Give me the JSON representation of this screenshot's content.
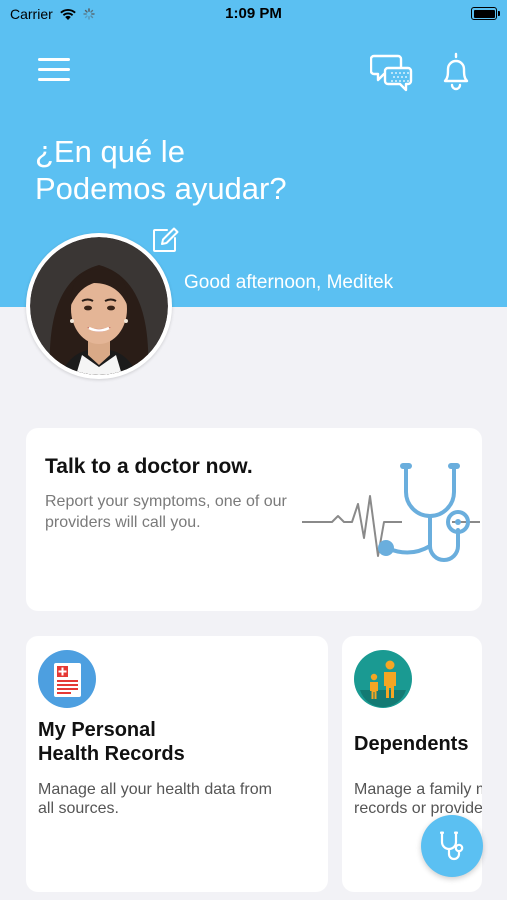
{
  "status_bar": {
    "carrier": "Carrier",
    "time": "1:09 PM"
  },
  "header": {
    "headline_line1": "¿En qué le",
    "headline_line2": "Podemos ayudar?",
    "greeting": "Good afternoon, Meditek",
    "background_color": "#5bc0f2"
  },
  "doctor_card": {
    "title": "Talk to a doctor now.",
    "description": "Report your symptoms, one of our providers will call you."
  },
  "cards": [
    {
      "title_line1": "My Personal",
      "title_line2": "Health Records",
      "description_line1": "Manage all your health data from",
      "description_line2": "all sources.",
      "icon": "health-record-icon"
    },
    {
      "title": "Dependents",
      "description_line1": "Manage a family m",
      "description_line2": "records or provide",
      "icon": "family-icon"
    }
  ],
  "icons": {
    "menu": "hamburger-menu-icon",
    "chat": "chat-bubbles-icon",
    "notifications": "bell-icon",
    "edit": "edit-icon",
    "fab": "stethoscope-icon"
  },
  "colors": {
    "accent": "#5bc0f2",
    "background": "#f2f2f6"
  }
}
